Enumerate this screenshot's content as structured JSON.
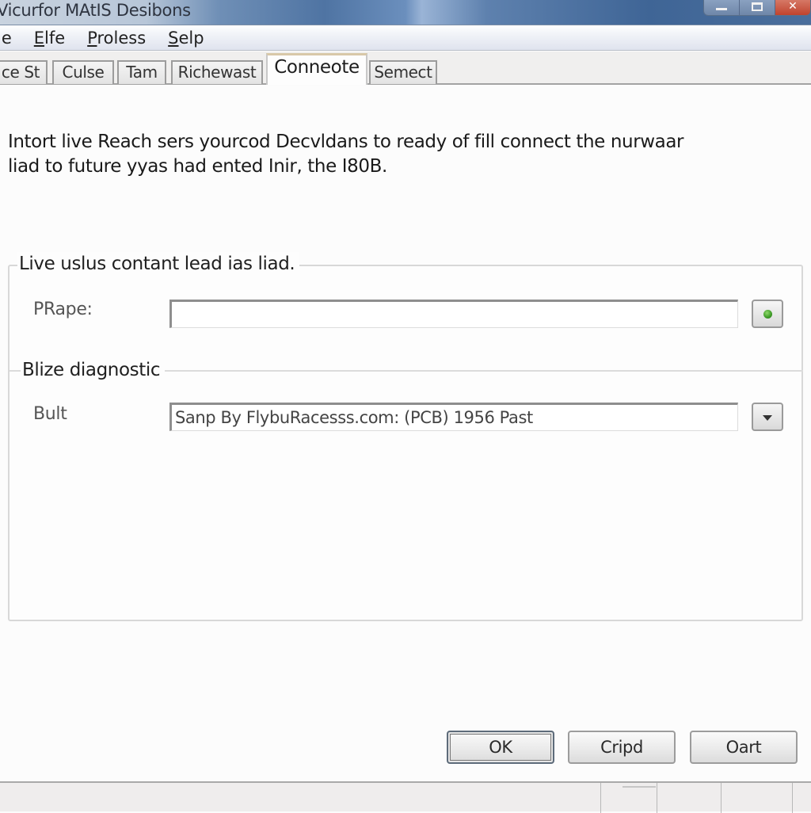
{
  "window": {
    "title": "Vicurfor MAtIS Desibons",
    "caption_buttons": {
      "minimize": "minimize",
      "maximize": "maximize",
      "close": "✕"
    }
  },
  "menu": {
    "items": [
      {
        "label": "le",
        "underline": ""
      },
      {
        "label": "Elfe",
        "underline": "E"
      },
      {
        "label": "Proless",
        "underline": "P"
      },
      {
        "label": "Selp",
        "underline": "S"
      }
    ]
  },
  "tabs": [
    {
      "label": "ce St",
      "active": false
    },
    {
      "label": "Culse",
      "active": false
    },
    {
      "label": "Tam",
      "active": false
    },
    {
      "label": "Richewast",
      "active": false
    },
    {
      "label": "Conneote",
      "active": true
    },
    {
      "label": "Semect",
      "active": false
    }
  ],
  "content": {
    "description_line1": "Intort live Reach sers yourcod Decvldans to ready of fill connect the nurwaar",
    "description_line2": "liad to future yyas had ented Inir, the I80B.",
    "group1": {
      "legend": "Live uslus contant lead ias liad.",
      "field_label": "PRape:",
      "field_value": "",
      "button_icon": "green-status-dot"
    },
    "group2": {
      "legend": "Blize diagnostic",
      "field_label": "Bult",
      "field_value": "Sanp By FlybuRacesss.com: (PCB) 1956 Past",
      "button_icon": "dropdown-arrow"
    }
  },
  "buttons": {
    "ok": "OK",
    "cancel": "Cripd",
    "other": "Oart"
  },
  "colors": {
    "titlebar_accent": "#4f74a3",
    "close_button": "#c0432e",
    "status_indicator": "#3c9a26"
  }
}
